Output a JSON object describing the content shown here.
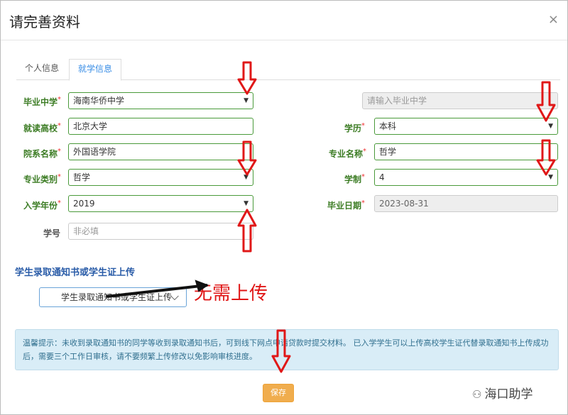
{
  "dialog": {
    "title": "请完善资料",
    "close": "×"
  },
  "tabs": [
    {
      "label": "个人信息"
    },
    {
      "label": "就学信息"
    }
  ],
  "form": {
    "middle_school": {
      "label": "毕业中学",
      "value": "海南华侨中学"
    },
    "middle_school_input": {
      "placeholder": "请输入毕业中学"
    },
    "university": {
      "label": "就读高校",
      "value": "北京大学"
    },
    "degree": {
      "label": "学历",
      "value": "本科"
    },
    "department": {
      "label": "院系名称",
      "value": "外国语学院"
    },
    "major": {
      "label": "专业名称",
      "value": "哲学"
    },
    "major_category": {
      "label": "专业类别",
      "value": "哲学"
    },
    "duration": {
      "label": "学制",
      "value": "4"
    },
    "enroll_year": {
      "label": "入学年份",
      "value": "2019"
    },
    "graduation_date": {
      "label": "毕业日期",
      "value": "2023-08-31"
    },
    "student_id": {
      "label": "学号",
      "placeholder": "非必填"
    }
  },
  "upload": {
    "section_title": "学生录取通知书或学生证上传",
    "button_label": "学生录取通知书或学生证上传",
    "annotation": "无需上传"
  },
  "tip": "温馨提示：未收到录取通知书的同学等收到录取通知书后，可到线下网点申请贷款时提交材料。 已入学学生可以上传高校学生证代替录取通知书上传成功后，需要三个工作日审核，请不要频繁上传修改以免影响审核进度。",
  "save_label": "保存",
  "watermark": "海口助学",
  "colors": {
    "annotation_red": "#e01818",
    "label_green": "#3c7c24",
    "save_orange": "#f0ad4e",
    "tab_blue": "#3a8ee6"
  }
}
